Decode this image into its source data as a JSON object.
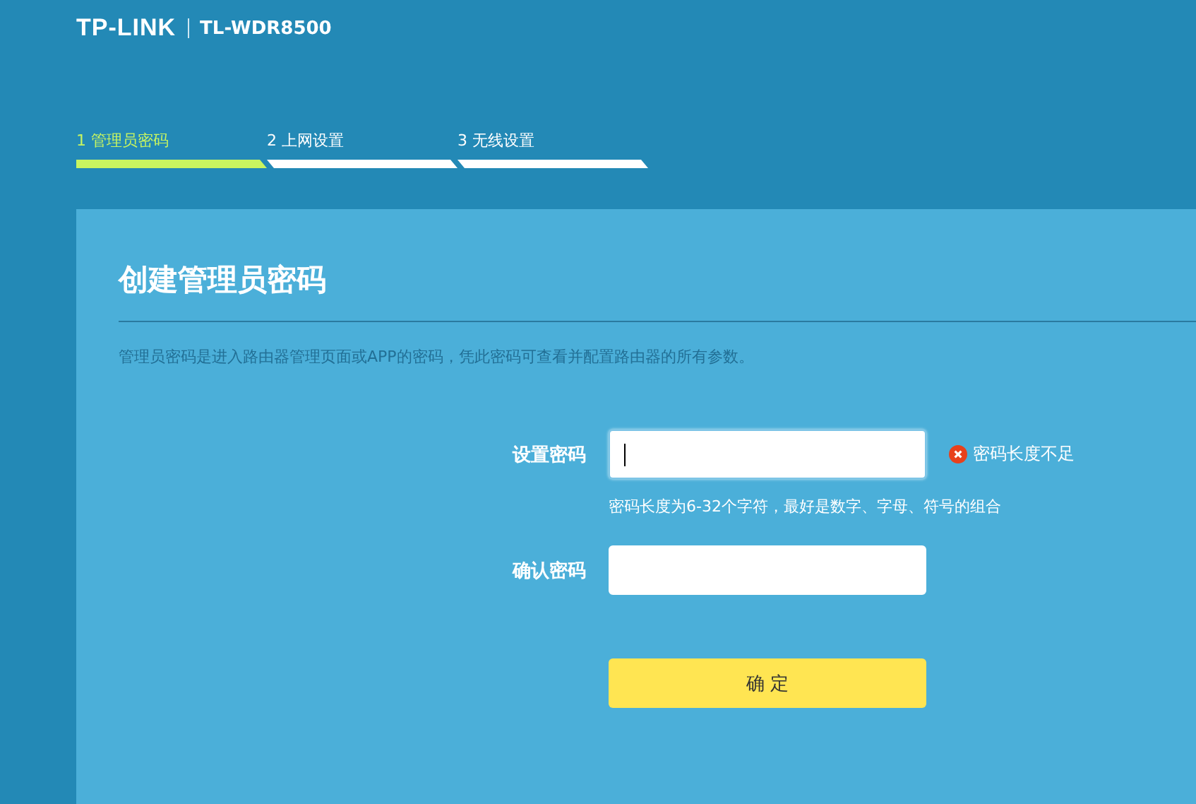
{
  "header": {
    "logo": "TP-LINK",
    "model": "TL-WDR8500"
  },
  "steps": [
    {
      "label": "1 管理员密码",
      "selected": true
    },
    {
      "label": "2 上网设置",
      "selected": false
    },
    {
      "label": "3 无线设置",
      "selected": false
    }
  ],
  "panel": {
    "title": "创建管理员密码",
    "description": "管理员密码是进入路由器管理页面或APP的密码，凭此密码可查看并配置路由器的所有参数。"
  },
  "fields": [
    {
      "label": "设置密码",
      "focused": true,
      "error": "密码长度不足",
      "hint": "密码长度为6-32个字符，最好是数字、字母、符号的组合"
    },
    {
      "label": "确认密码",
      "focused": false
    }
  ],
  "submit": "确 定"
}
